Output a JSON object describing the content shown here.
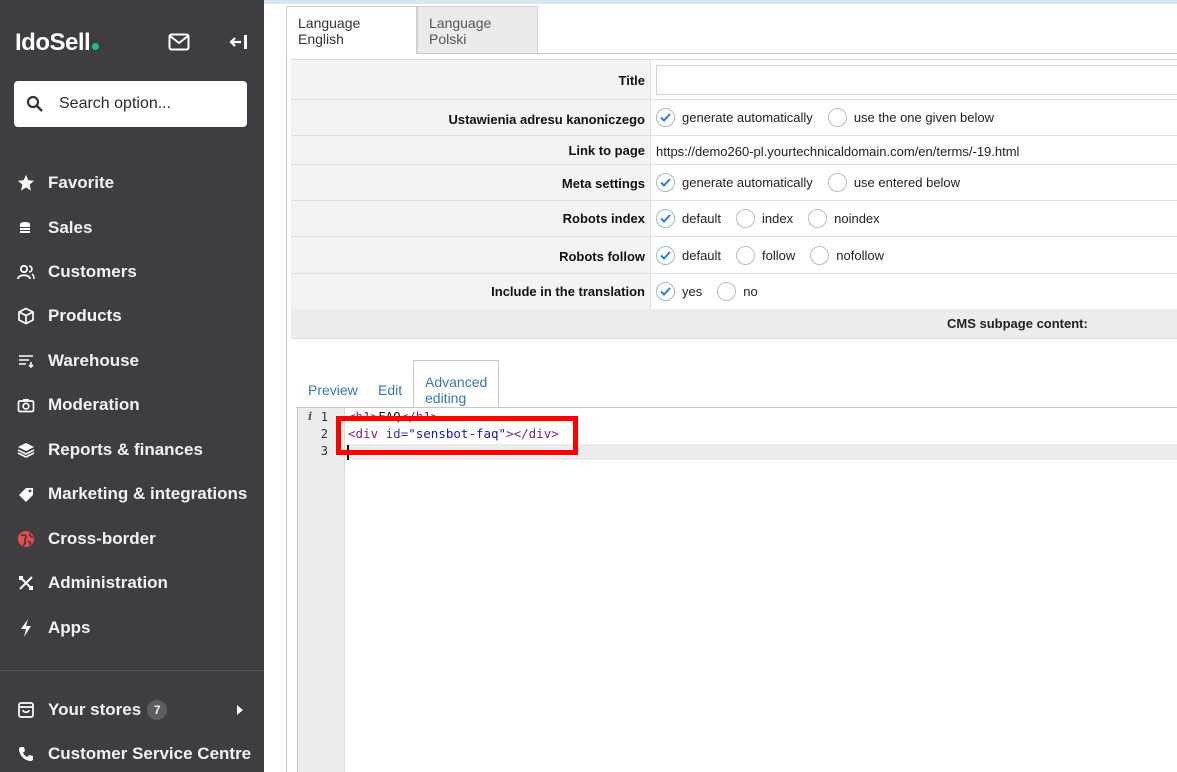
{
  "sidebar": {
    "logo": "IdoSell",
    "search_placeholder": "Search option...",
    "items": [
      {
        "label": "Favorite",
        "icon": "star-icon"
      },
      {
        "label": "Sales",
        "icon": "coins-icon"
      },
      {
        "label": "Customers",
        "icon": "users-icon"
      },
      {
        "label": "Products",
        "icon": "box-icon"
      },
      {
        "label": "Warehouse",
        "icon": "warehouse-icon"
      },
      {
        "label": "Moderation",
        "icon": "camera-icon"
      },
      {
        "label": "Reports & finances",
        "icon": "layers-icon"
      },
      {
        "label": "Marketing & integrations",
        "icon": "tag-icon"
      },
      {
        "label": "Cross-border",
        "icon": "globe-icon"
      },
      {
        "label": "Administration",
        "icon": "tools-icon"
      },
      {
        "label": "Apps",
        "icon": "bolt-icon"
      }
    ],
    "stores": {
      "label": "Your stores",
      "count": "7"
    },
    "service": {
      "label": "Customer Service Centre"
    }
  },
  "language_tabs": [
    "Language English",
    "Language Polski"
  ],
  "form": {
    "title_label": "Title",
    "title_value": "",
    "canonical_label": "Ustawienia adresu kanoniczego",
    "canonical_options": [
      "generate automatically",
      "use the one given below"
    ],
    "link_label": "Link to page",
    "link_value": "https://demo260-pl.yourtechnicaldomain.com/en/terms/-19.html",
    "meta_label": "Meta settings",
    "meta_options": [
      "generate automatically",
      "use entered below"
    ],
    "robots_index_label": "Robots index",
    "robots_index_options": [
      "default",
      "index",
      "noindex"
    ],
    "robots_follow_label": "Robots follow",
    "robots_follow_options": [
      "default",
      "follow",
      "nofollow"
    ],
    "translation_label": "Include in the translation",
    "translation_options": [
      "yes",
      "no"
    ],
    "cms_header": "CMS subpage content:"
  },
  "editor_tabs": [
    "Preview",
    "Edit",
    "Advanced editing"
  ],
  "editor": {
    "line_numbers": [
      "1",
      "2",
      "3"
    ],
    "line1": {
      "open": "<h1>",
      "text": "FAQ",
      "close": "</h1>"
    },
    "line2": {
      "tag_open": "<div ",
      "attr": "id=",
      "value": "\"sensbot-faq\"",
      "tag_close": "></div>"
    }
  },
  "colors": {
    "sidebar_bg": "#3d3d42",
    "accent_green": "#21c07a",
    "highlight": "#ff0000",
    "tab_link": "#3a76b2"
  }
}
